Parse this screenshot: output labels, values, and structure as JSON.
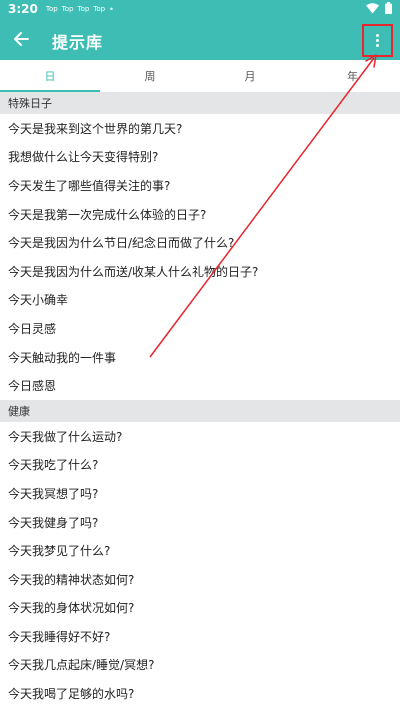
{
  "status_bar": {
    "time": "3:20",
    "apps": [
      "Top",
      "Top",
      "Top",
      "Top"
    ],
    "dot": "•"
  },
  "app_bar": {
    "title": "提示库"
  },
  "tabs": [
    {
      "label": "日",
      "active": true
    },
    {
      "label": "周",
      "active": false
    },
    {
      "label": "月",
      "active": false
    },
    {
      "label": "年",
      "active": false
    }
  ],
  "sections": [
    {
      "header": "特殊日子",
      "items": [
        "今天是我来到这个世界的第几天?",
        "我想做什么让今天变得特别?",
        "今天发生了哪些值得关注的事?",
        "今天是我第一次完成什么体验的日子?",
        "今天是我因为什么节日/纪念日而做了什么?",
        "今天是我因为什么而送/收某人什么礼物的日子?",
        "今天小确幸",
        "今日灵感",
        "今天触动我的一件事",
        "今日感恩"
      ]
    },
    {
      "header": "健康",
      "items": [
        "今天我做了什么运动?",
        "今天我吃了什么?",
        "今天我冥想了吗?",
        "今天我健身了吗?",
        "今天我梦见了什么?",
        "今天我的精神状态如何?",
        "今天我的身体状况如何?",
        "今天我睡得好不好?",
        "今天我几点起床/睡觉/冥想?",
        "今天我喝了足够的水吗?"
      ]
    }
  ],
  "colors": {
    "primary": "#3dbdb4",
    "annotation": "#e8262d",
    "section_bg": "#e3e5e7"
  },
  "icons": {
    "back": "arrow-left-icon",
    "more": "more-vertical-icon",
    "wifi": "wifi-icon",
    "battery": "battery-icon"
  }
}
